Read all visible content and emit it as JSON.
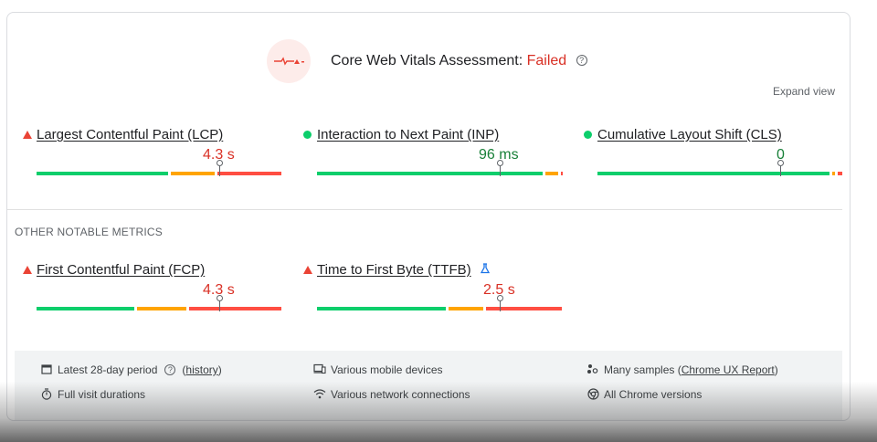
{
  "assessment": {
    "title": "Core Web Vitals Assessment:",
    "status": "Failed",
    "help": "?",
    "expand_label": "Expand view"
  },
  "core_metrics": [
    {
      "name": "Largest Contentful Paint (LCP)",
      "value": "4.3 s",
      "rating": "poor",
      "marker_fraction": 0.74
    },
    {
      "name": "Interaction to Next Paint (INP)",
      "value": "96 ms",
      "rating": "good",
      "marker_fraction": 0.75
    },
    {
      "name": "Cumulative Layout Shift (CLS)",
      "value": "0",
      "rating": "good",
      "marker_fraction": 0.75
    }
  ],
  "other": {
    "title": "OTHER NOTABLE METRICS",
    "metrics": [
      {
        "name": "First Contentful Paint (FCP)",
        "value": "4.3 s",
        "rating": "poor",
        "marker_fraction": 0.74,
        "experimental": false
      },
      {
        "name": "Time to First Byte (TTFB)",
        "value": "2.5 s",
        "rating": "poor",
        "marker_fraction": 0.75,
        "experimental": true
      }
    ]
  },
  "footer": {
    "period": "Latest 28-day period",
    "history_link": "history",
    "devices": "Various mobile devices",
    "samples_prefix": "Many samples (",
    "samples_link": "Chrome UX Report",
    "samples_suffix": ")",
    "durations": "Full visit durations",
    "network": "Various network connections",
    "chrome_versions": "All Chrome versions"
  },
  "icons": {
    "assessment": "failed-assessment-icon",
    "poor": "red-triangle-icon",
    "good": "green-dot-icon",
    "lab": "flask-icon",
    "calendar": "calendar-icon",
    "devices": "devices-icon",
    "samples": "samples-icon",
    "timer": "timer-icon",
    "network": "wifi-icon",
    "chrome": "chrome-icon"
  },
  "colors": {
    "good": "#0cce6b",
    "needs_improvement": "#ffa400",
    "poor": "#ff4e42",
    "failed_text": "#d93025",
    "good_text": "#188038"
  }
}
